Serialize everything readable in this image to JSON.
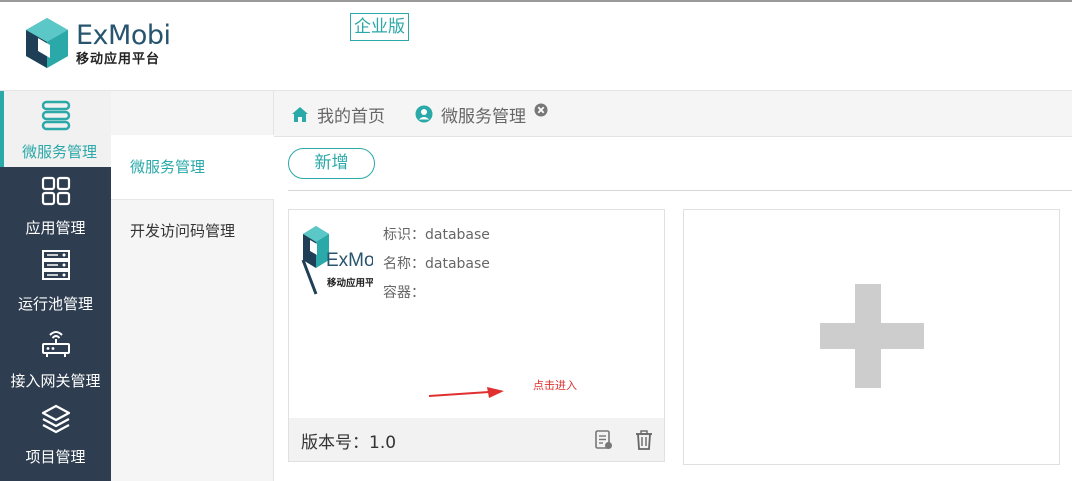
{
  "header": {
    "logo_en": "ExMobi",
    "logo_cn": "移动应用平台",
    "edition": "企业版"
  },
  "nav": {
    "items": [
      {
        "label": "微服务管理",
        "icon": "server-stack-icon"
      },
      {
        "label": "应用管理",
        "icon": "grid-icon"
      },
      {
        "label": "运行池管理",
        "icon": "server-rack-icon"
      },
      {
        "label": "接入网关管理",
        "icon": "router-icon"
      },
      {
        "label": "项目管理",
        "icon": "layers-icon"
      }
    ]
  },
  "submenu": {
    "items": [
      {
        "label": "微服务管理"
      },
      {
        "label": "开发访问码管理"
      }
    ]
  },
  "tabs": {
    "home": "我的首页",
    "current": "微服务管理"
  },
  "toolbar": {
    "add_label": "新增"
  },
  "card": {
    "logo_en": "ExMobi",
    "logo_cn": "移动应用平台",
    "id_label": "标识：database",
    "name_label": "名称：database",
    "container_label": "容器：",
    "version_label": "版本号：1.0"
  },
  "annotation": {
    "text": "点击进入"
  },
  "colors": {
    "accent": "#2ba8a8",
    "nav_bg": "#2e3d50",
    "annotation": "#e03030"
  }
}
